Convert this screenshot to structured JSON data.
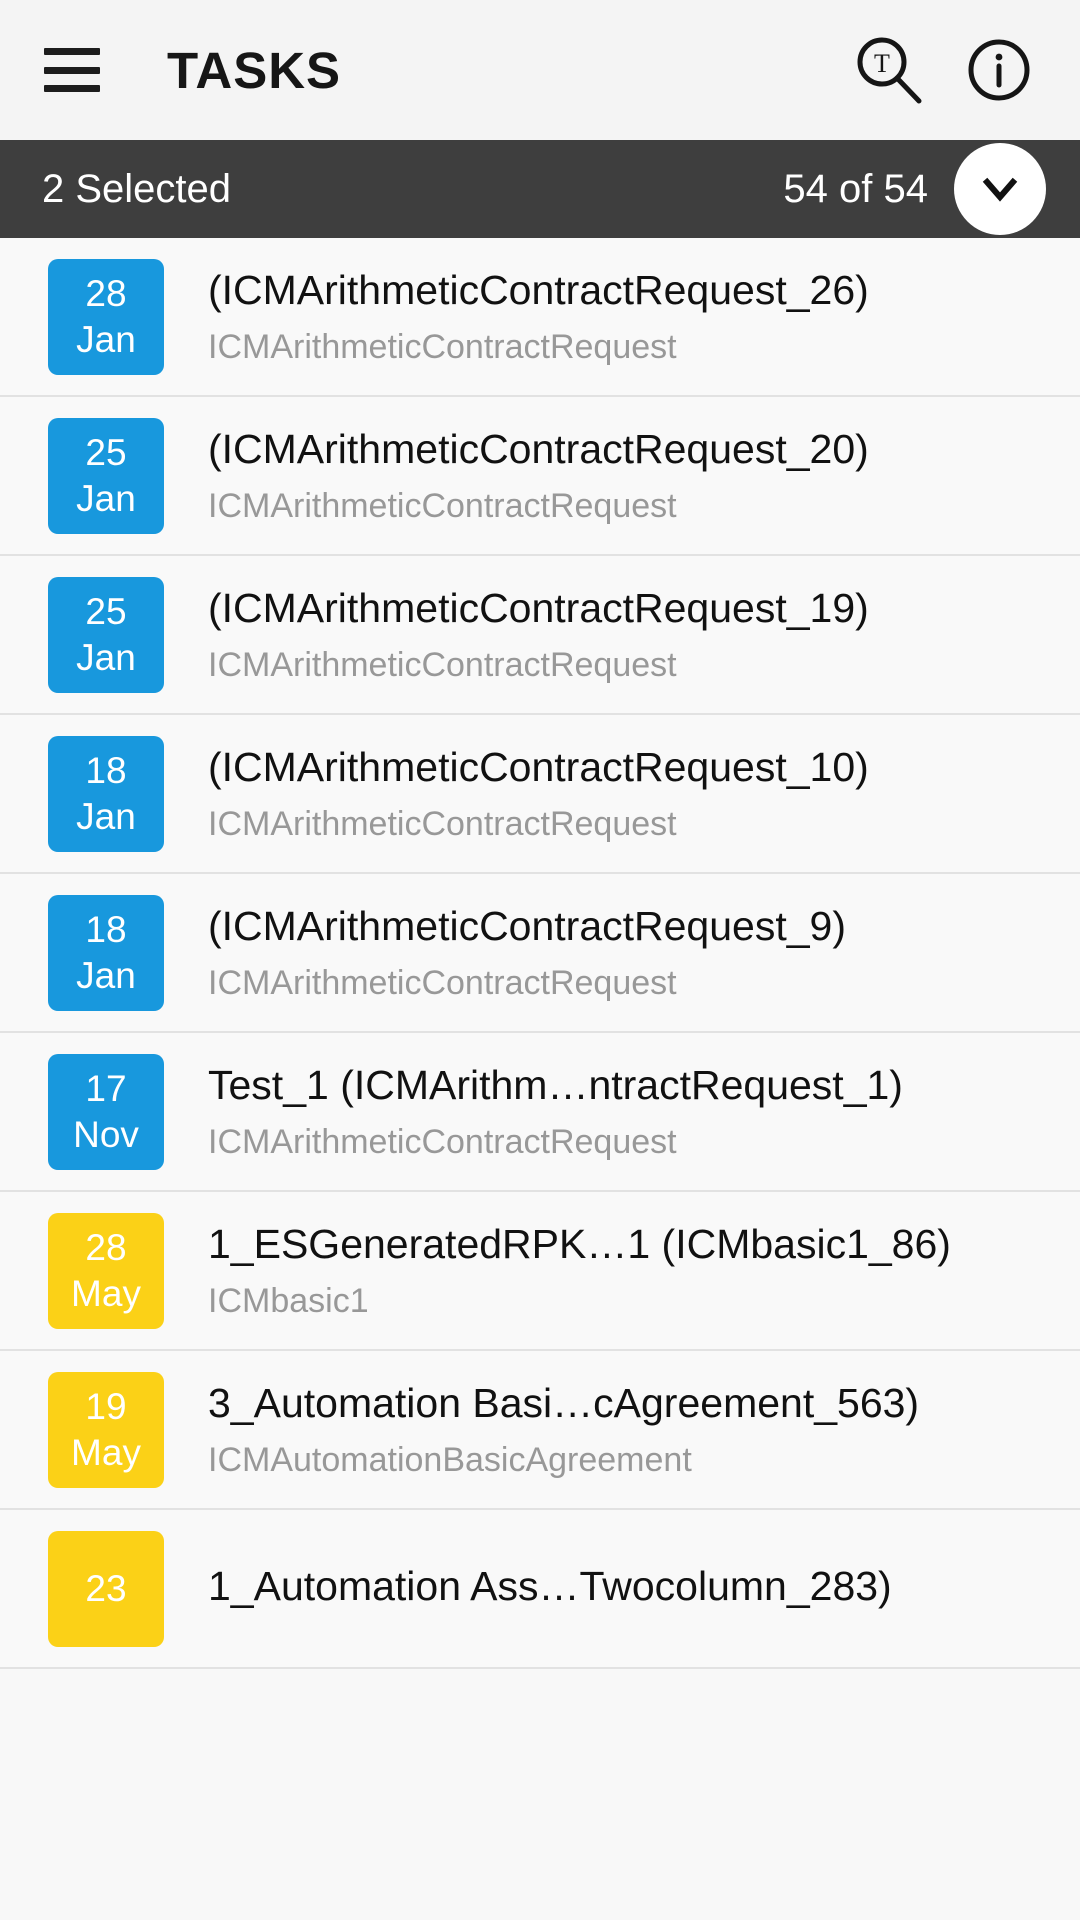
{
  "appbar": {
    "menu_icon": "hamburger-menu-icon",
    "title": "TASKS",
    "search_icon": "text-search-icon",
    "search_icon_glyph": "T",
    "info_icon": "info-icon"
  },
  "selection_bar": {
    "selected_label": "2 Selected",
    "count_label": "54 of 54",
    "expand_icon": "chevron-down-icon",
    "background": "#3e3e3e"
  },
  "colors": {
    "chip_blue": "#1898dd",
    "chip_yellow": "#fbd117",
    "app_background": "#f8f8f8",
    "appbar_background": "#f4f4f4",
    "title_text": "#111111",
    "subtitle_text": "#989898"
  },
  "list": {
    "items": [
      {
        "day": "28",
        "month": "Jan",
        "color": "#1898dd",
        "title": "(ICMArithmeticContractRequest_26)",
        "subtitle": "ICMArithmeticContractRequest"
      },
      {
        "day": "25",
        "month": "Jan",
        "color": "#1898dd",
        "title": "(ICMArithmeticContractRequest_20)",
        "subtitle": "ICMArithmeticContractRequest"
      },
      {
        "day": "25",
        "month": "Jan",
        "color": "#1898dd",
        "title": "(ICMArithmeticContractRequest_19)",
        "subtitle": "ICMArithmeticContractRequest"
      },
      {
        "day": "18",
        "month": "Jan",
        "color": "#1898dd",
        "title": "(ICMArithmeticContractRequest_10)",
        "subtitle": "ICMArithmeticContractRequest"
      },
      {
        "day": "18",
        "month": "Jan",
        "color": "#1898dd",
        "title": "(ICMArithmeticContractRequest_9)",
        "subtitle": "ICMArithmeticContractRequest"
      },
      {
        "day": "17",
        "month": "Nov",
        "color": "#1898dd",
        "title": "Test_1 (ICMArithm…ntractRequest_1)",
        "subtitle": "ICMArithmeticContractRequest"
      },
      {
        "day": "28",
        "month": "May",
        "color": "#fbd117",
        "title": "1_ESGeneratedRPK…1 (ICMbasic1_86)",
        "subtitle": "ICMbasic1"
      },
      {
        "day": "19",
        "month": "May",
        "color": "#fbd117",
        "title": "3_Automation Basi…cAgreement_563)",
        "subtitle": "ICMAutomationBasicAgreement"
      },
      {
        "day": "23",
        "month": "",
        "color": "#fbd117",
        "title": "1_Automation Ass…Twocolumn_283)",
        "subtitle": ""
      }
    ]
  }
}
